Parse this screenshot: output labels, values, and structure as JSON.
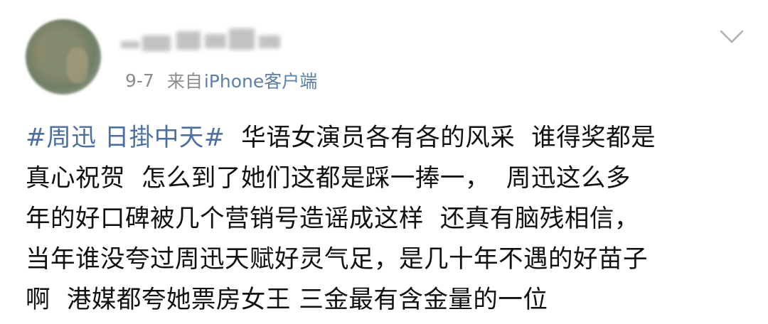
{
  "post": {
    "date": "9-7",
    "source_prefix": "来自",
    "source_name": "iPhone客户端",
    "hashtag": "#周迅 日掛中天#",
    "lines": [
      "  华语女演员各有各的风采  谁得奖都是",
      "真心祝贺  怎么到了她们这都是踩一捧一，  周迅这么多",
      "年的好口碑被几个营销号造谣成这样  还真有脑残相信，",
      "当年谁没夸过周迅天赋好灵气足，是几十年不遇的好苗子",
      "啊  港媒都夸她票房女王 三金最有含金量的一位"
    ]
  },
  "icons": {
    "menu": "chevron-down-icon"
  },
  "colors": {
    "hashtag": "#4a6fa5",
    "source_link": "#5a7fa8",
    "meta_text": "#8c8c8c",
    "body_text": "#111111"
  }
}
